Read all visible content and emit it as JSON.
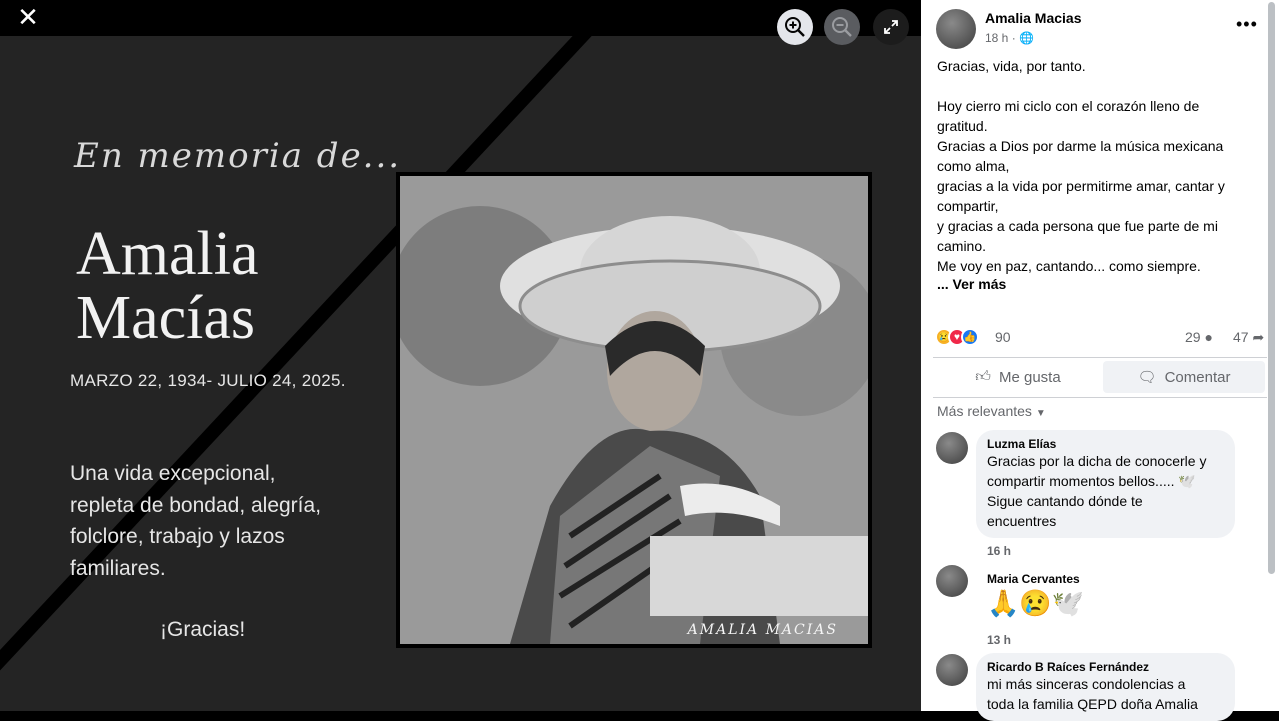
{
  "viewer": {
    "script_title": "En memoria de...",
    "name_line1": "Amalia",
    "name_line2": "Macías",
    "dates": "MARZO 22, 1934- JULIO 24, 2025.",
    "tribute_lines": [
      "Una vida excepcional,",
      "repleta de bondad, alegría,",
      "folclore, trabajo y lazos",
      "familiares."
    ],
    "thanks": "¡Gracias!",
    "watermark": "AMALIA MACIAS",
    "close_icon": "close-icon",
    "zoom_in_icon": "zoom-in-icon",
    "zoom_out_icon": "zoom-out-icon",
    "fullscreen_icon": "fullscreen-icon"
  },
  "post": {
    "author": "Amalia Macias",
    "meta": "18 h · 🌐",
    "lines": [
      "Gracias, vida, por tanto.",
      "",
      "Hoy cierro mi ciclo con el corazón lleno de",
      "gratitud.",
      "Gracias a Dios por darme la música mexicana",
      "como alma,",
      "gracias a la vida por permitirme amar, cantar y",
      "compartir,",
      "y gracias a cada persona que fue parte de mi",
      "camino.",
      "Me voy en paz, cantando... como siempre."
    ],
    "see_more": "... Ver más",
    "reaction_count": "90",
    "comment_count": "29",
    "share_count": "47",
    "like_label": "Me gusta",
    "comment_label": "Comentar",
    "relevance_label": "Más relevantes"
  },
  "comments": [
    {
      "name": "Luzma Elías",
      "lines": [
        "Gracias por la dicha de conocerle y",
        "compartir momentos bellos..... 🕊️",
        "Sigue cantando dónde te",
        "encuentres"
      ],
      "time": "16 h"
    },
    {
      "name": "Maria Cervantes",
      "lines": [
        "🙏😢🕊️"
      ],
      "time": "13 h"
    },
    {
      "name": "Ricardo B Raíces Fernández",
      "lines": [
        "mi más sinceras condolencias a",
        "toda la familia QEPD doña Amalia"
      ],
      "time": ""
    }
  ],
  "colors": {
    "viewer_bg": "#242424",
    "panel_bg": "#ffffff",
    "bubble_bg": "#f0f2f5",
    "meta_text": "#65676b",
    "like_blue": "#1877f2",
    "love_red": "#f02849",
    "sad_yellow": "#f7b125"
  }
}
